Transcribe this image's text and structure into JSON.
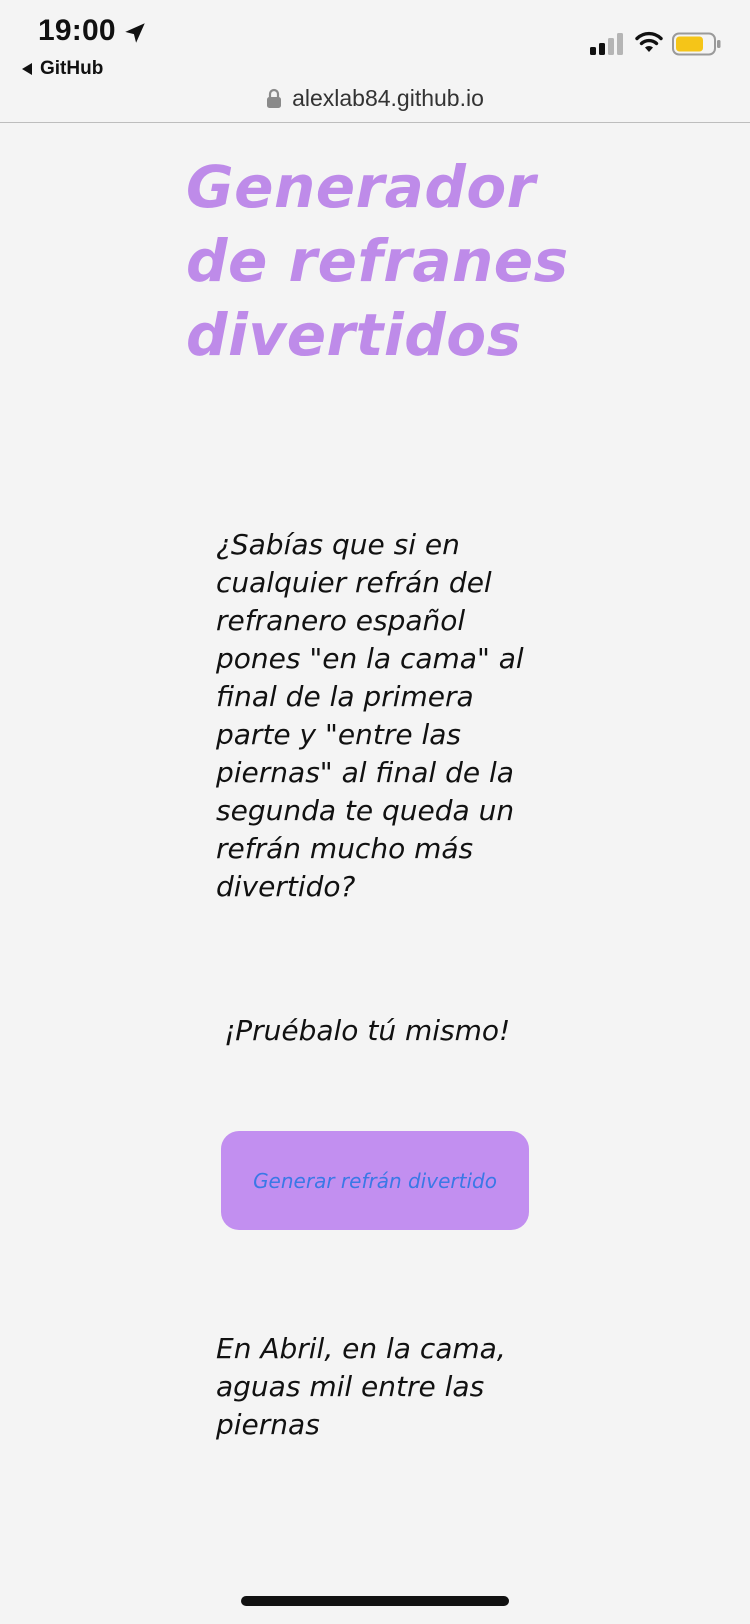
{
  "status_bar": {
    "time": "19:00",
    "back_label": "GitHub",
    "battery_color": "#f5c518",
    "icons": [
      "location-arrow-icon",
      "back-triangle-icon",
      "cellular-signal-icon",
      "wifi-icon",
      "battery-icon"
    ]
  },
  "url_bar": {
    "domain": "alexlab84.github.io",
    "icon": "lock-icon"
  },
  "main": {
    "title": "Generador de refranes divertidos",
    "intro": "¿Sabías que si en cualquier refrán del refranero español pones \"en la cama\" al final de la primera parte y \"entre las piernas\" al final de la segunda te queda un refrán mucho más divertido?",
    "try_it": "¡Pruébalo tú mismo!",
    "button_label": "Generar refrán divertido",
    "proverb": "En Abril, en la cama, aguas mil entre las piernas"
  },
  "colors": {
    "title": "#be8be9",
    "button_bg": "#c28ff0",
    "button_text": "#3a78e6",
    "page_bg": "#f4f4f4"
  }
}
